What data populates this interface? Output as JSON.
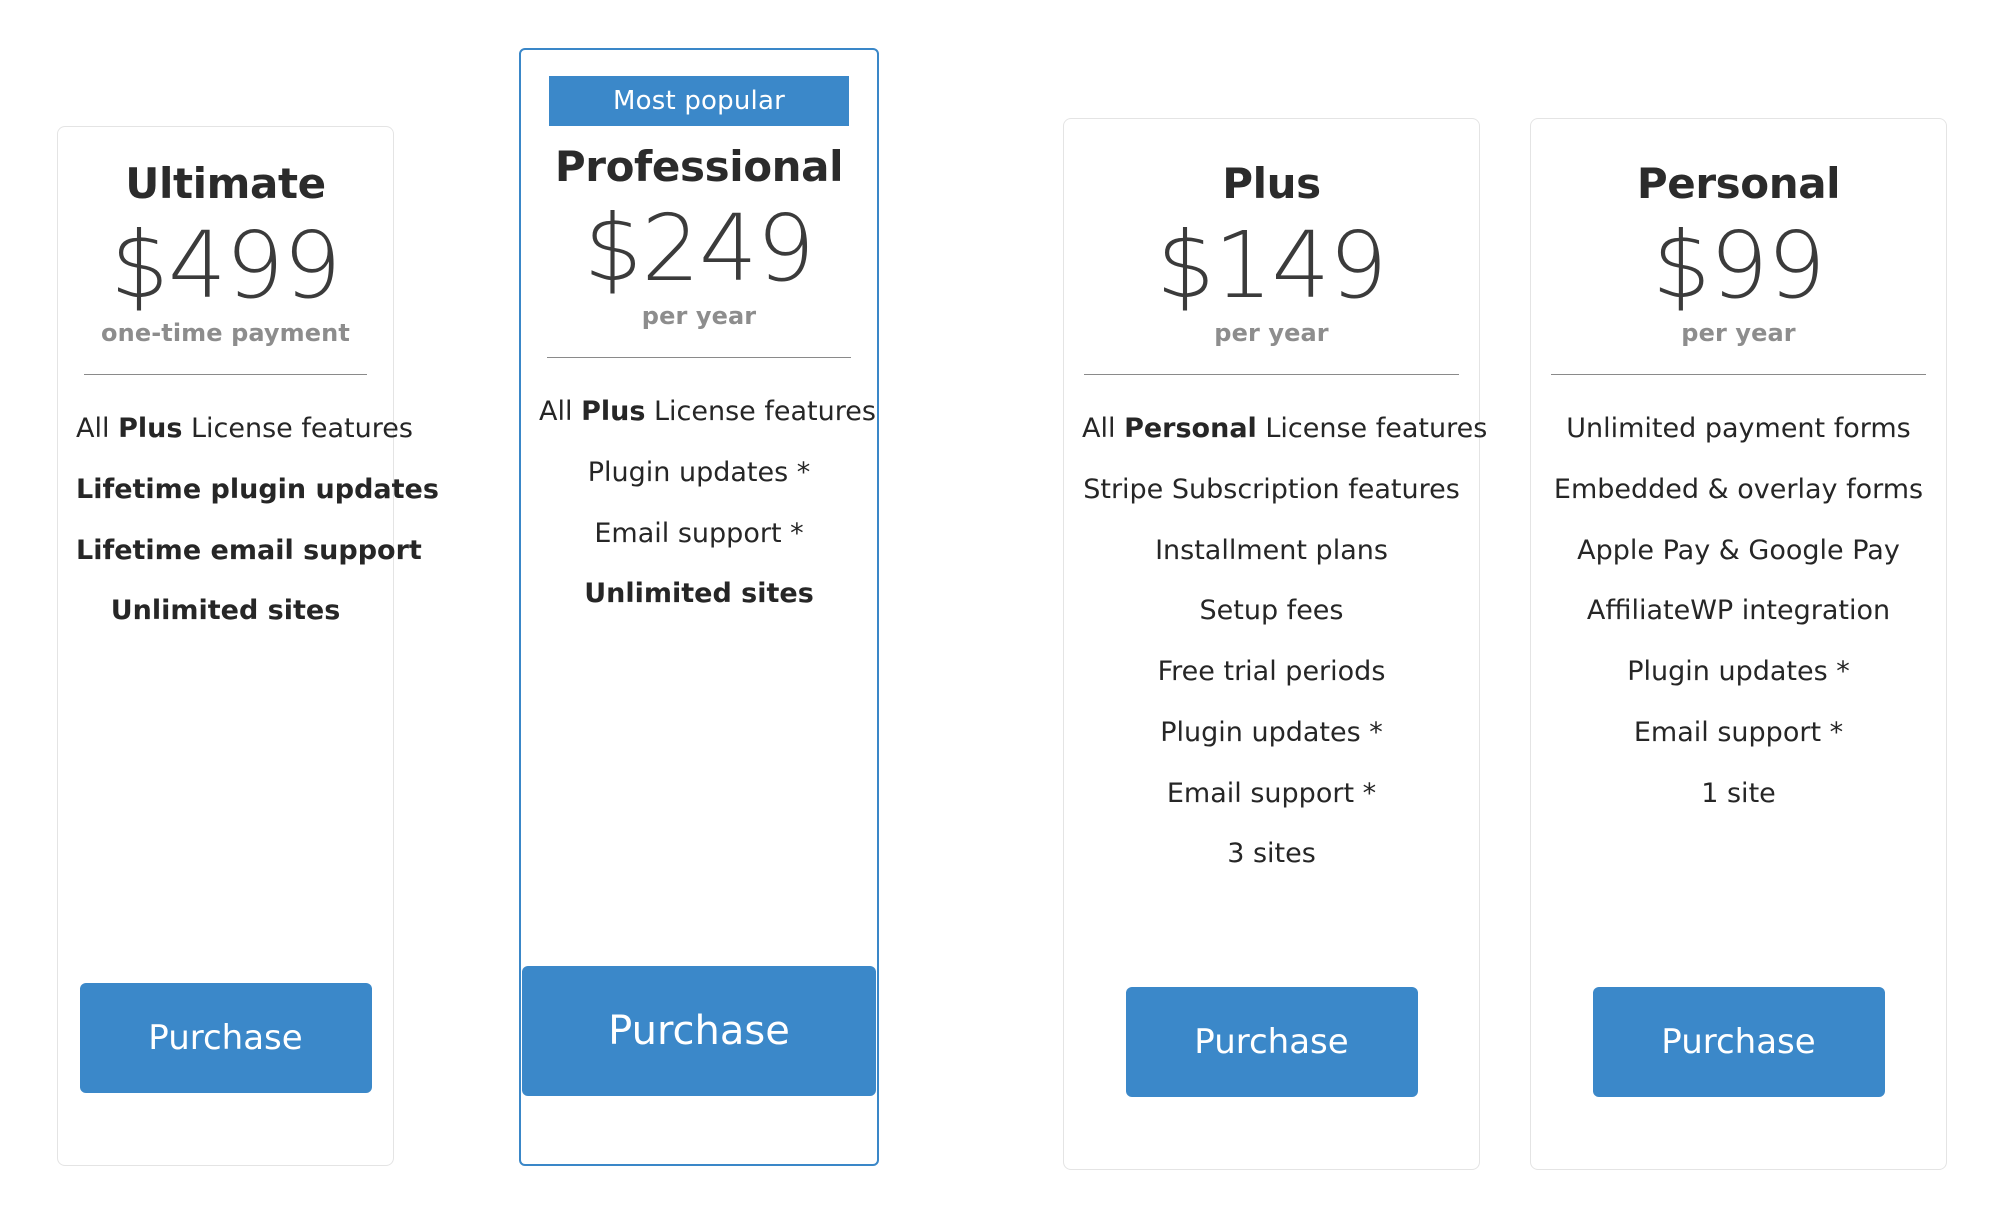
{
  "page": {
    "title": "Pricing Plans",
    "accent_color": "#3b88c9",
    "featured_border_color": "#3a87c8",
    "card_border_color": "#e4e4e4",
    "text_color": "#262626",
    "muted_text_color": "#8d8d8d"
  },
  "plans": [
    {
      "id": "ultimate",
      "name": "Ultimate",
      "price": "$499",
      "period": "one-time payment",
      "featured": false,
      "badge": null,
      "features": [
        {
          "prefix": "All ",
          "bold": "Plus",
          "suffix": " License features",
          "strong": false
        },
        {
          "prefix": "",
          "bold": "",
          "suffix": "Lifetime plugin updates",
          "strong": true
        },
        {
          "prefix": "",
          "bold": "",
          "suffix": "Lifetime email support",
          "strong": true
        },
        {
          "prefix": "",
          "bold": "",
          "suffix": "Unlimited sites",
          "strong": true
        }
      ],
      "cta": "Purchase"
    },
    {
      "id": "professional",
      "name": "Professional",
      "price": "$249",
      "period": "per year",
      "featured": true,
      "badge": "Most popular",
      "features": [
        {
          "prefix": "All ",
          "bold": "Plus",
          "suffix": " License features",
          "strong": false
        },
        {
          "prefix": "",
          "bold": "",
          "suffix": "Plugin updates *",
          "strong": false
        },
        {
          "prefix": "",
          "bold": "",
          "suffix": "Email support *",
          "strong": false
        },
        {
          "prefix": "",
          "bold": "",
          "suffix": "Unlimited sites",
          "strong": true
        }
      ],
      "cta": "Purchase"
    },
    {
      "id": "plus",
      "name": "Plus",
      "price": "$149",
      "period": "per year",
      "featured": false,
      "badge": null,
      "features": [
        {
          "prefix": "All ",
          "bold": "Personal",
          "suffix": " License features",
          "strong": false
        },
        {
          "prefix": "",
          "bold": "",
          "suffix": "Stripe Subscription features",
          "strong": false
        },
        {
          "prefix": "",
          "bold": "",
          "suffix": "Installment plans",
          "strong": false
        },
        {
          "prefix": "",
          "bold": "",
          "suffix": "Setup fees",
          "strong": false
        },
        {
          "prefix": "",
          "bold": "",
          "suffix": "Free trial periods",
          "strong": false
        },
        {
          "prefix": "",
          "bold": "",
          "suffix": "Plugin updates *",
          "strong": false
        },
        {
          "prefix": "",
          "bold": "",
          "suffix": "Email support *",
          "strong": false
        },
        {
          "prefix": "",
          "bold": "",
          "suffix": "3 sites",
          "strong": false
        }
      ],
      "cta": "Purchase"
    },
    {
      "id": "personal",
      "name": "Personal",
      "price": "$99",
      "period": "per year",
      "featured": false,
      "badge": null,
      "features": [
        {
          "prefix": "",
          "bold": "",
          "suffix": "Unlimited payment forms",
          "strong": false
        },
        {
          "prefix": "",
          "bold": "",
          "suffix": "Embedded & overlay forms",
          "strong": false
        },
        {
          "prefix": "",
          "bold": "",
          "suffix": "Apple Pay & Google Pay",
          "strong": false
        },
        {
          "prefix": "",
          "bold": "",
          "suffix": "AffiliateWP integration",
          "strong": false
        },
        {
          "prefix": "",
          "bold": "",
          "suffix": "Plugin updates *",
          "strong": false
        },
        {
          "prefix": "",
          "bold": "",
          "suffix": "Email support *",
          "strong": false
        },
        {
          "prefix": "",
          "bold": "",
          "suffix": "1 site",
          "strong": false
        }
      ],
      "cta": "Purchase"
    }
  ]
}
